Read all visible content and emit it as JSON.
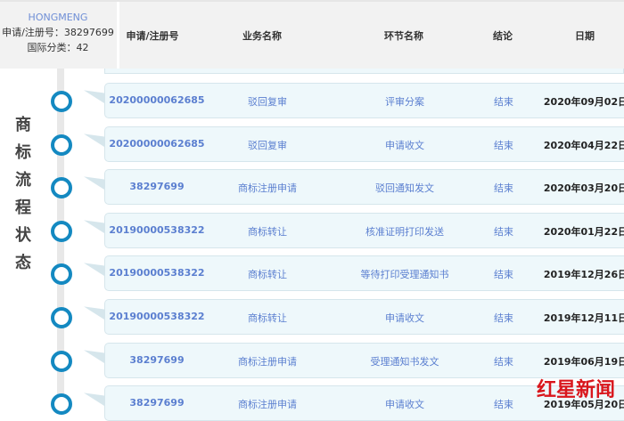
{
  "info": {
    "brand": "HONGMENG",
    "reg": "申请/注册号：38297699",
    "class": "国际分类：42"
  },
  "columns": [
    "申请/注册号",
    "业务名称",
    "环节名称",
    "结论",
    "日期"
  ],
  "side_title": [
    "商",
    "标",
    "流",
    "程",
    "状",
    "态"
  ],
  "rows": [
    {
      "num": "20200000062685",
      "biz": "驳回复审",
      "step": "评审分案",
      "result": "结束",
      "date": "2020年09月02日"
    },
    {
      "num": "20200000062685",
      "biz": "驳回复审",
      "step": "申请收文",
      "result": "结束",
      "date": "2020年04月22日"
    },
    {
      "num": "38297699",
      "biz": "商标注册申请",
      "step": "驳回通知发文",
      "result": "结束",
      "date": "2020年03月20日"
    },
    {
      "num": "20190000538322",
      "biz": "商标转让",
      "step": "核准证明打印发送",
      "result": "结束",
      "date": "2020年01月22日"
    },
    {
      "num": "20190000538322",
      "biz": "商标转让",
      "step": "等待打印受理通知书",
      "result": "结束",
      "date": "2019年12月26日"
    },
    {
      "num": "20190000538322",
      "biz": "商标转让",
      "step": "申请收文",
      "result": "结束",
      "date": "2019年12月11日"
    },
    {
      "num": "38297699",
      "biz": "商标注册申请",
      "step": "受理通知书发文",
      "result": "结束",
      "date": "2019年06月19日"
    },
    {
      "num": "38297699",
      "biz": "商标注册申请",
      "step": "申请收文",
      "result": "结束",
      "date": "2019年05月20日"
    }
  ],
  "watermark": "红星新闻"
}
